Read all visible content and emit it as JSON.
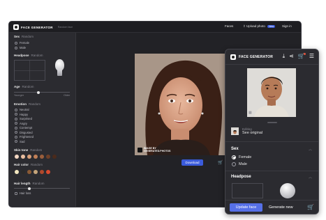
{
  "desktop": {
    "brand": "FACE GENERATOR",
    "brand_sub": "Random face",
    "nav": {
      "faces": "Faces",
      "upload": "Upload photo",
      "upload_badge": "New",
      "signin": "Sign in"
    },
    "sidebar": {
      "sex": {
        "title": "Sex",
        "random": "Random",
        "options": [
          "Female",
          "Male"
        ]
      },
      "headpose": {
        "title": "Headpose",
        "random": "Random"
      },
      "age": {
        "title": "Age",
        "random": "Random",
        "min": "Younger",
        "max": "Older"
      },
      "emotion": {
        "title": "Emotion",
        "random": "Random",
        "options": [
          "Neutral",
          "Happy",
          "Surprised",
          "Angry",
          "Contempt",
          "Disgusted",
          "Frightened",
          "Sad"
        ]
      },
      "skin": {
        "title": "Skin tone",
        "random": "Random",
        "colors": [
          "#f3d7c2",
          "#e9bea0",
          "#d9a07a",
          "#c07f57",
          "#9a5e3c",
          "#6e3f27",
          "#4a2a1b"
        ]
      },
      "hair_color": {
        "title": "Hair color",
        "random": "Random",
        "colors": [
          "#f2e6c0",
          "#2a2a2a",
          "#8a5a35",
          "#c4a47a",
          "#b0492b",
          "#d94a2e"
        ]
      },
      "hair_length": {
        "title": "Hair length",
        "random": "Random",
        "options": [
          "Hair loss"
        ]
      }
    },
    "watermark": {
      "line1": "IMAGE BY",
      "line2": "GENERATED.PHOTOS"
    },
    "download": "Download"
  },
  "mobile": {
    "brand": "FACE GENERATOR",
    "editing": "Editing",
    "see_original": "See original",
    "sex": {
      "title": "Sex",
      "options": [
        "Female",
        "Male"
      ],
      "selected": "Female"
    },
    "headpose": {
      "title": "Headpose"
    },
    "update": "Update face",
    "generate": "Generate new"
  }
}
